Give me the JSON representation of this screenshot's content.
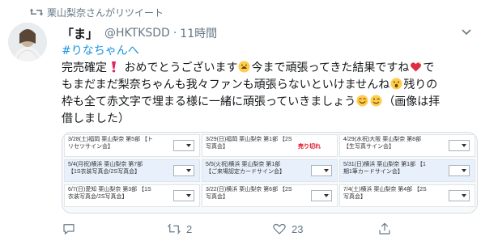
{
  "retweet": {
    "label": "栗山梨奈さんがリツイート",
    "icon": "retweet-icon"
  },
  "tweet": {
    "display_name": "「ま」",
    "handle": "@HKTKSDD",
    "separator": "·",
    "time": "11時間",
    "hashtag": "#りなちゃんへ",
    "text_parts": [
      "完売確定",
      "おめでとうございます",
      "今まで頑張ってきた結果ですね",
      "で",
      "もまだまだ梨奈ちゃんも我々ファンも頑張らないといけませんね",
      "残りの",
      "枠も全て赤文字で埋まる様に一緒に頑張っていきましょう",
      "（画像は拝",
      "借しました）"
    ]
  },
  "media": {
    "rows": [
      [
        {
          "label": "3/28(土)福岡 栗山梨奈 第5部 【トリセツサイン会】",
          "status": ""
        },
        {
          "label": "3/29(日)福岡 栗山梨奈 第1部 【2S写真会】",
          "status": "売り切れ"
        },
        {
          "label": "4/29(水祝)大阪 栗山梨奈 第8部 【生写真サイン会】",
          "status": ""
        }
      ],
      [
        {
          "label": "5/4(月祝)横浜 栗山梨奈 第7部 【1S衣装写真会/2S写真会】",
          "status": ""
        },
        {
          "label": "5/5(火祝)横浜 栗山梨奈 第1部 【ご来場認定カードサイン会】",
          "status": ""
        },
        {
          "label": "5/31(日)横浜 栗山梨奈 第1部 【1期1筆カードサイン会】",
          "status": ""
        }
      ],
      [
        {
          "label": "6/7(日)愛知 栗山梨奈 第3部 【1S衣装写真会/2S写真会】",
          "status": ""
        },
        {
          "label": "3/22(日)横浜 栗山梨奈 第6部 【2S写真会】",
          "status": ""
        },
        {
          "label": "7/4(土)横浜 栗山梨奈 第4部 【2S写真会】",
          "status": ""
        }
      ]
    ]
  },
  "actions": {
    "reply_count": "",
    "retweet_count": "2",
    "like_count": "23",
    "share_count": ""
  },
  "colors": {
    "accent": "#1b95e0",
    "muted": "#657786",
    "sold_out": "#e0001b",
    "like": "#657786"
  }
}
